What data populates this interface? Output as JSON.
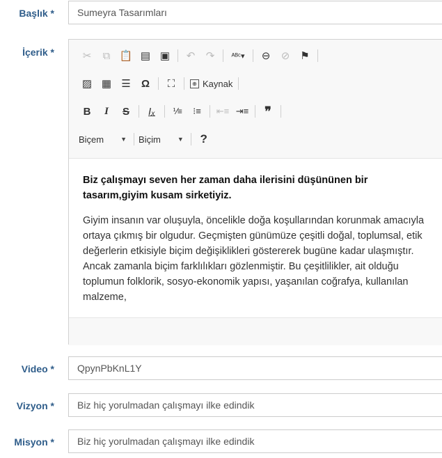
{
  "form": {
    "title_label": "Başlık *",
    "title_value": "Sumeyra Tasarımları",
    "content_label": "İçerik *",
    "video_label": "Video *",
    "video_value": "QpynPbKnL1Y",
    "vision_label": "Vizyon *",
    "vision_value": "Biz hiç yorulmadan çalışmayı ilke edindik",
    "mission_label": "Misyon *",
    "mission_value": "Biz hiç yorulmadan çalışmayı ilke edindik"
  },
  "editor": {
    "source_label": "Kaynak",
    "style_label": "Biçem",
    "format_label": "Biçim",
    "help_label": "?",
    "lead_text": "Biz çalışmayı seven her zaman daha ilerisini düşününen bir tasarım,giyim kusam sirketiyiz.",
    "body_text": "Giyim insanın var oluşuyla, öncelikle doğa koşullarından korunmak amacıyla ortaya çıkmış bir olgudur. Geçmişten günümüze çeşitli doğal, toplumsal, etik değerlerin etkisiyle biçim değişiklikleri göstererek bugüne kadar ulaşmıştır. Ancak zamanla biçim farklılıkları gözlenmiştir. Bu çeşitlilikler, ait olduğu toplumun folklorik, sosyo-ekonomik yapısı, yaşanılan coğrafya, kullanılan malzeme,"
  },
  "icons": {
    "row1": [
      "cut-icon",
      "copy-icon",
      "paste-icon",
      "paste-text-icon",
      "paste-word-icon",
      "undo-icon",
      "redo-icon",
      "spellcheck-icon",
      "link-icon",
      "unlink-icon",
      "anchor-flag-icon"
    ],
    "row2": [
      "image-icon",
      "table-icon",
      "horizontal-rule-icon",
      "special-char-icon",
      "maximize-icon",
      "source-icon"
    ],
    "row3": [
      "bold-icon",
      "italic-icon",
      "strike-icon",
      "remove-format-icon",
      "numbered-list-icon",
      "bulleted-list-icon",
      "outdent-icon",
      "indent-icon",
      "blockquote-icon"
    ]
  }
}
